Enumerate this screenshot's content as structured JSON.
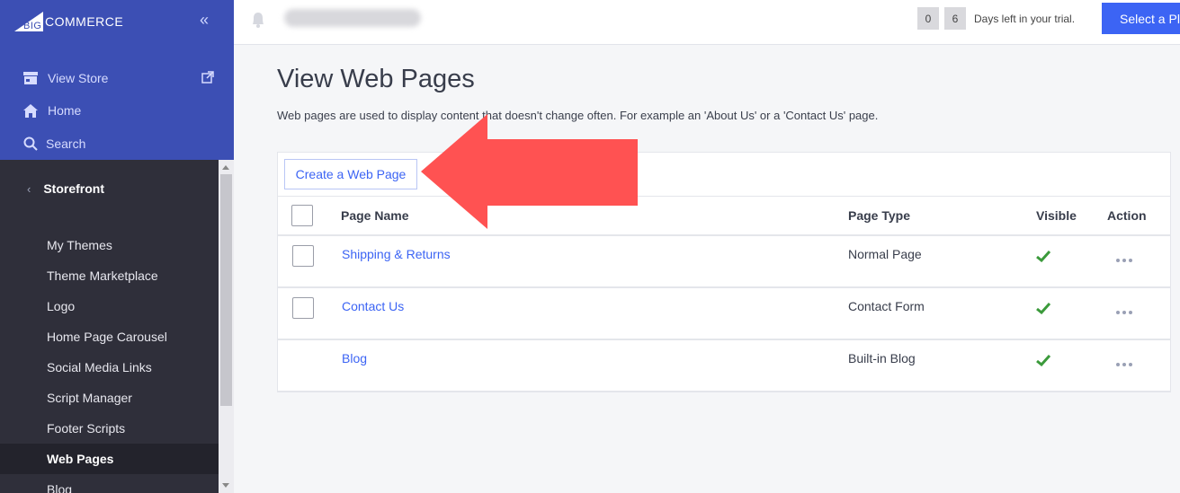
{
  "brand": {
    "logo_text": "COMMERCE",
    "logo_prefix": "BIG"
  },
  "sidebar": {
    "top_items": [
      {
        "label": "View Store",
        "icon": "store-icon"
      },
      {
        "label": "Home",
        "icon": "home-icon"
      },
      {
        "label": "Search",
        "icon": "search-icon"
      }
    ],
    "section_title": "Storefront",
    "items": [
      {
        "label": "My Themes"
      },
      {
        "label": "Theme Marketplace"
      },
      {
        "label": "Logo"
      },
      {
        "label": "Home Page Carousel"
      },
      {
        "label": "Social Media Links"
      },
      {
        "label": "Script Manager"
      },
      {
        "label": "Footer Scripts"
      },
      {
        "label": "Web Pages",
        "active": true
      },
      {
        "label": "Blog"
      }
    ]
  },
  "header": {
    "trial_digits": [
      "0",
      "6"
    ],
    "trial_text": "Days left in your trial.",
    "plan_button": "Select a Pla"
  },
  "main": {
    "title": "View Web Pages",
    "description": "Web pages are used to display content that doesn't change often. For example an 'About Us' or a 'Contact Us' page.",
    "create_button": "Create a Web Page",
    "columns": [
      "Page Name",
      "Page Type",
      "Visible",
      "Action"
    ],
    "rows": [
      {
        "name": "Shipping & Returns",
        "type": "Normal Page",
        "visible": true,
        "selectable": true
      },
      {
        "name": "Contact Us",
        "type": "Contact Form",
        "visible": true,
        "selectable": true
      },
      {
        "name": "Blog",
        "type": "Built-in Blog",
        "visible": true,
        "selectable": false
      }
    ]
  },
  "colors": {
    "sidebar_top": "#3c4fb4",
    "sidebar_dark": "#2f2f3a",
    "accent": "#3c64f4",
    "arrow": "#ff5252",
    "check": "#3b9a3b"
  }
}
